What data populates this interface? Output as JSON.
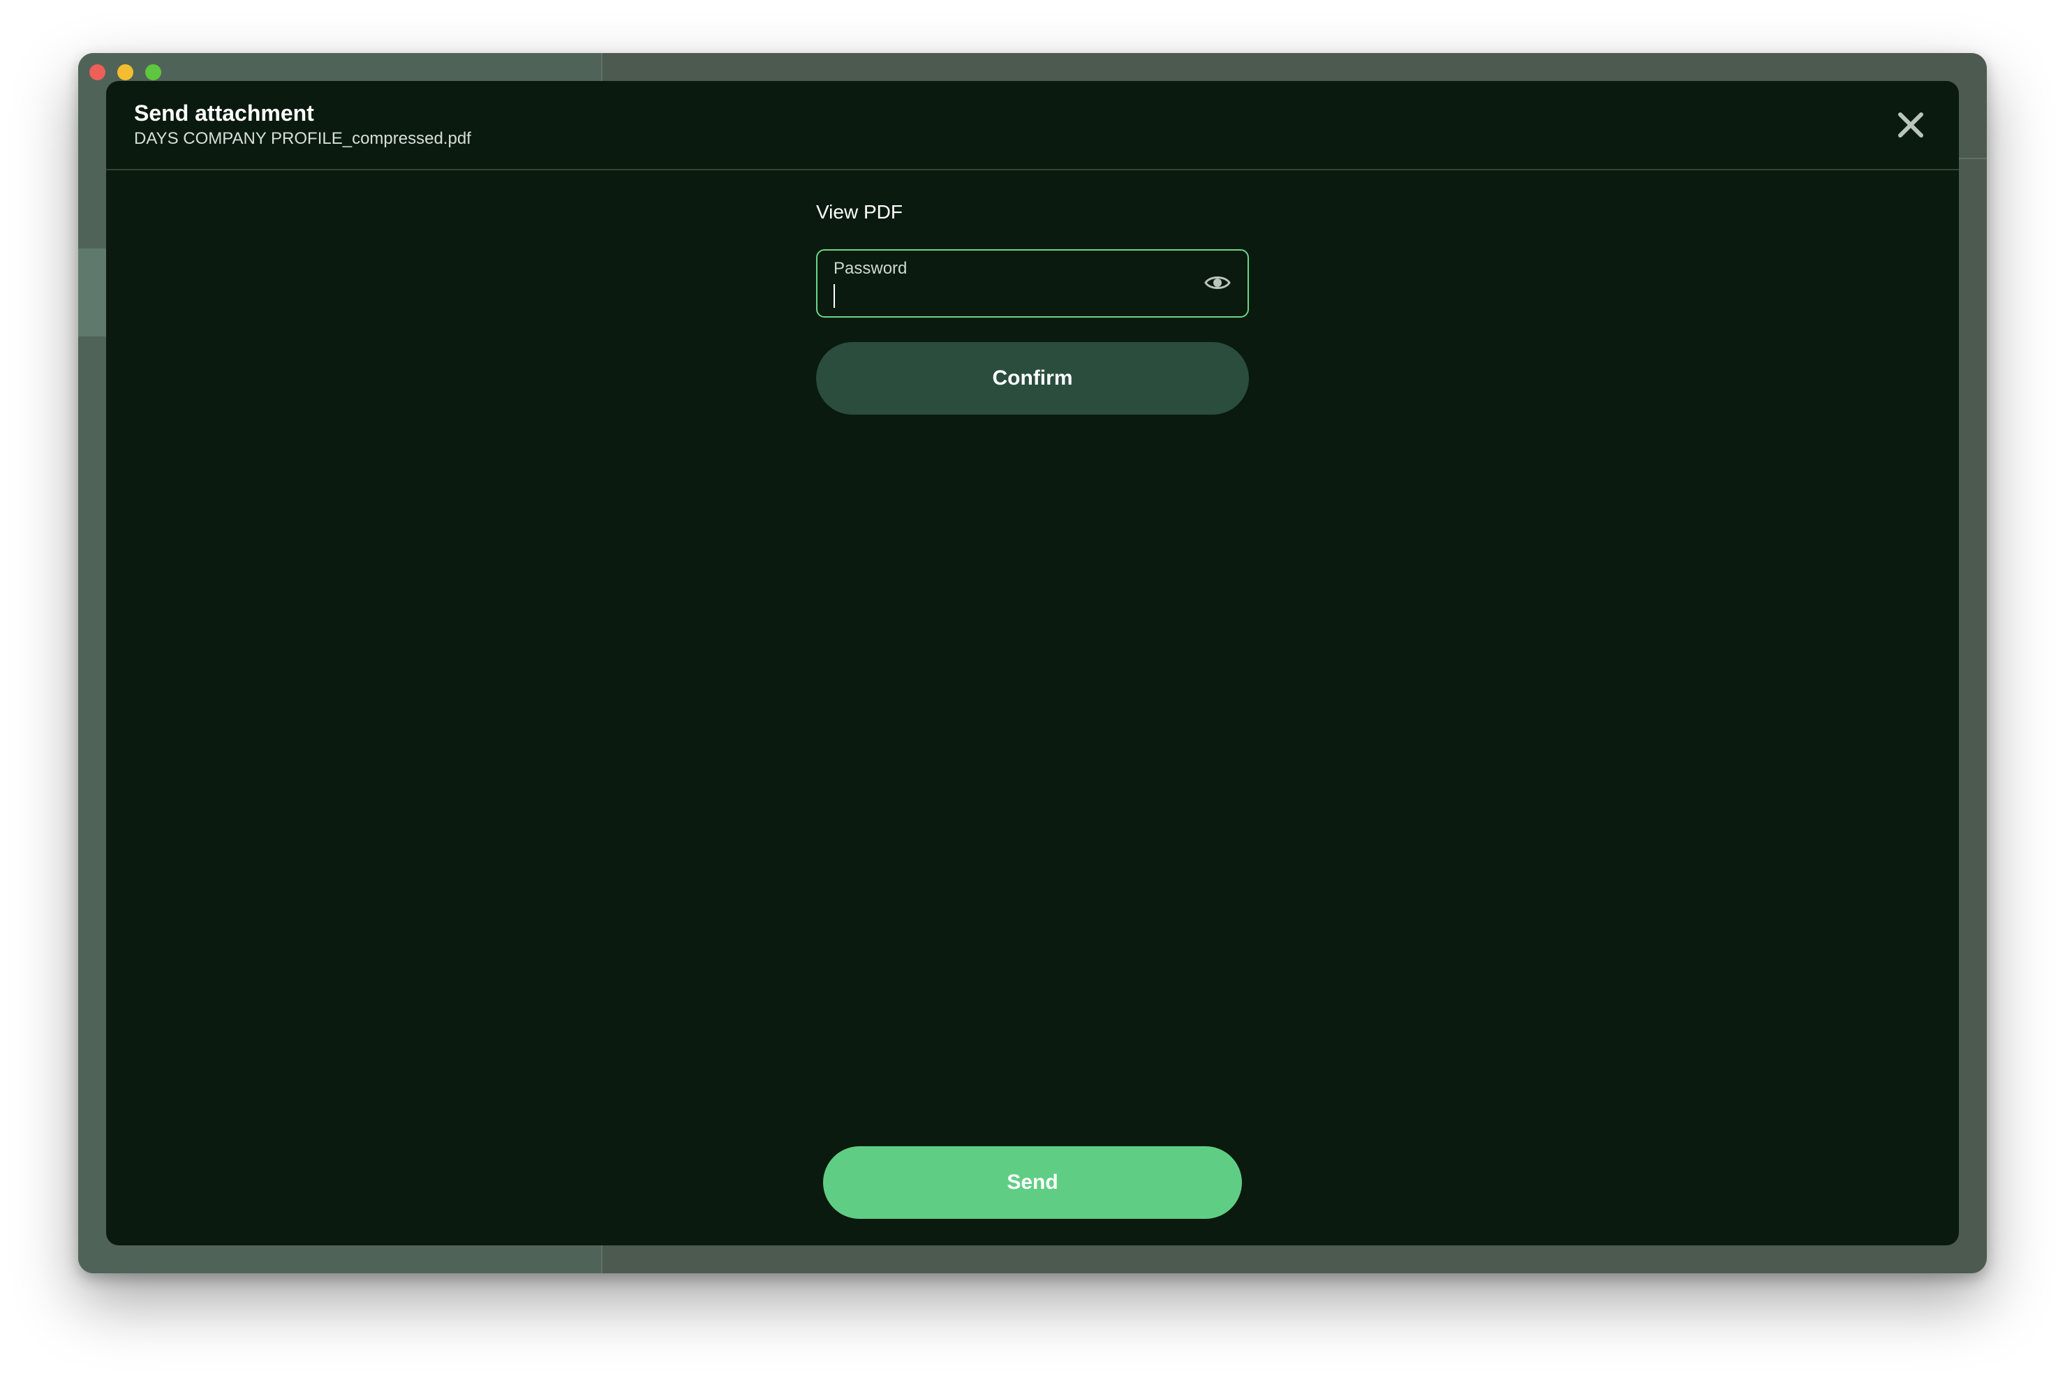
{
  "window": {
    "controls": [
      "close",
      "minimize",
      "maximize"
    ]
  },
  "modal": {
    "title": "Send attachment",
    "subtitle": "DAYS COMPANY PROFILE_compressed.pdf",
    "close_icon": "close-icon"
  },
  "form": {
    "section_label": "View PDF",
    "password": {
      "label": "Password",
      "value": "",
      "toggle_icon": "eye-icon"
    },
    "confirm_label": "Confirm"
  },
  "footer": {
    "send_label": "Send"
  },
  "colors": {
    "modal_background": "#0b1a0e",
    "accent": "#5fce84",
    "confirm_background": "#2a4d3d",
    "field_border": "#6bd68a"
  }
}
